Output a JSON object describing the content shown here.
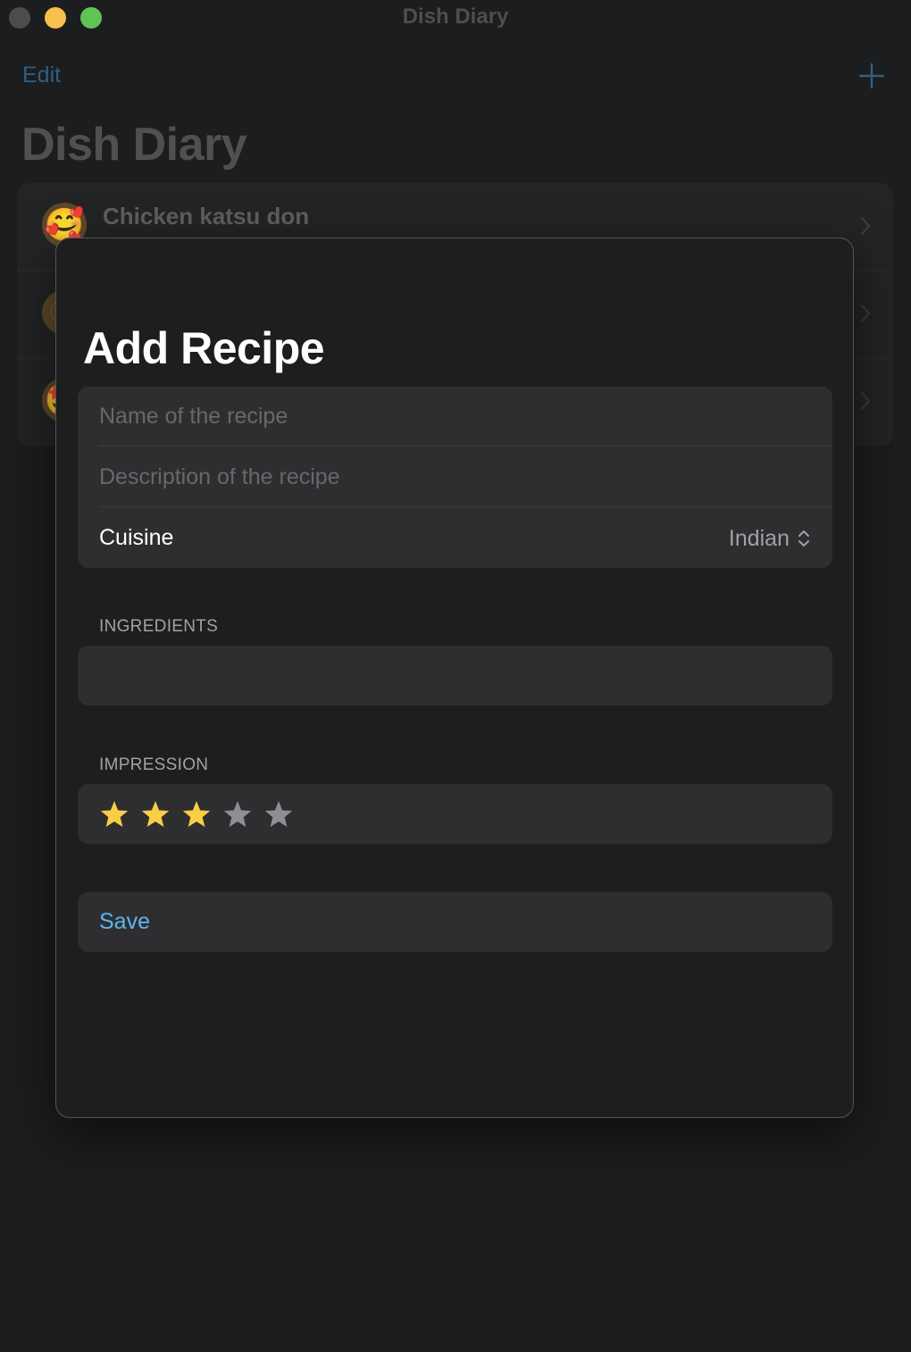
{
  "window": {
    "title": "Dish Diary"
  },
  "nav": {
    "edit_label": "Edit",
    "add_icon": "plus-icon"
  },
  "page": {
    "title": "Dish Diary"
  },
  "list": {
    "items": [
      {
        "title": "Chicken katsu don",
        "emoji": "🥰"
      },
      {
        "title": "",
        "emoji": "😋"
      },
      {
        "title": "",
        "emoji": "🤩"
      }
    ]
  },
  "sheet": {
    "title": "Add Recipe",
    "name_placeholder": "Name of the recipe",
    "description_placeholder": "Description of the recipe",
    "cuisine_label": "Cuisine",
    "cuisine_value": "Indian",
    "ingredients_header": "INGREDIENTS",
    "impression_header": "IMPRESSION",
    "rating": 3,
    "rating_max": 5,
    "save_label": "Save"
  },
  "colors": {
    "accent": "#5eb4f0",
    "star_filled": "#f7ce45",
    "star_empty": "#8e8e93",
    "traffic_close": "#4b4c4e",
    "traffic_minimize": "#f6c04a",
    "traffic_maximize": "#5fc454"
  }
}
